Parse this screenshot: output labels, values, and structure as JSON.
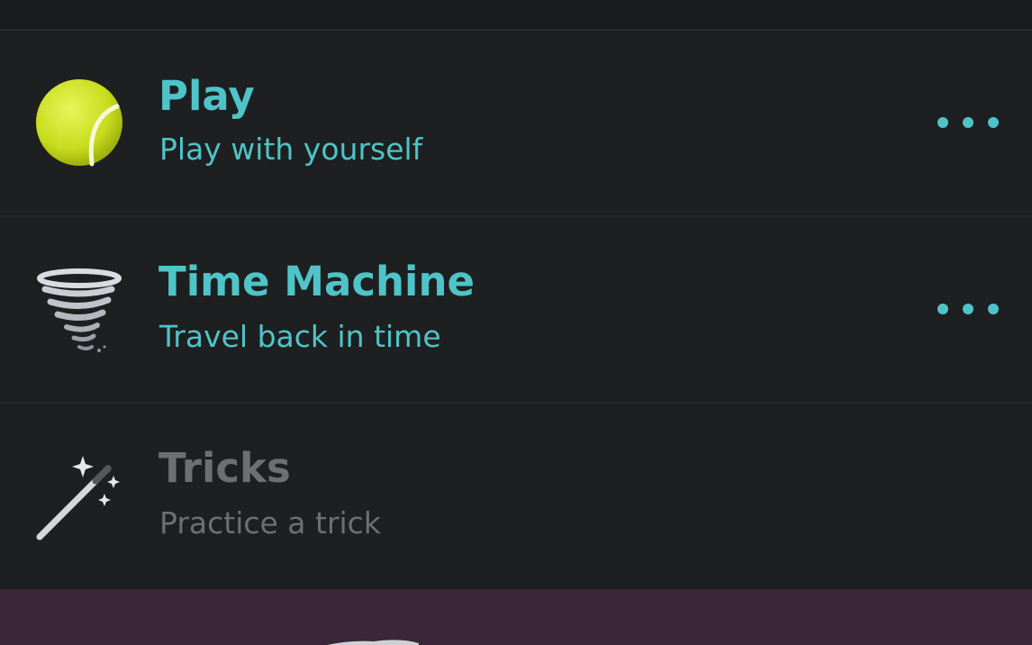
{
  "menu": {
    "items": [
      {
        "title": "Play",
        "subtitle": "Play with yourself",
        "icon": "tennis-ball-icon",
        "state": "active"
      },
      {
        "title": "Time Machine",
        "subtitle": "Travel back in time",
        "icon": "tornado-icon",
        "state": "active"
      },
      {
        "title": "Tricks",
        "subtitle": "Practice a trick",
        "icon": "magic-wand-icon",
        "state": "disabled"
      }
    ]
  },
  "colors": {
    "background": "#1e1f20",
    "accent": "#4fc4c8",
    "disabled_text": "#6e6f71",
    "bottom_panel": "#3a2638"
  }
}
